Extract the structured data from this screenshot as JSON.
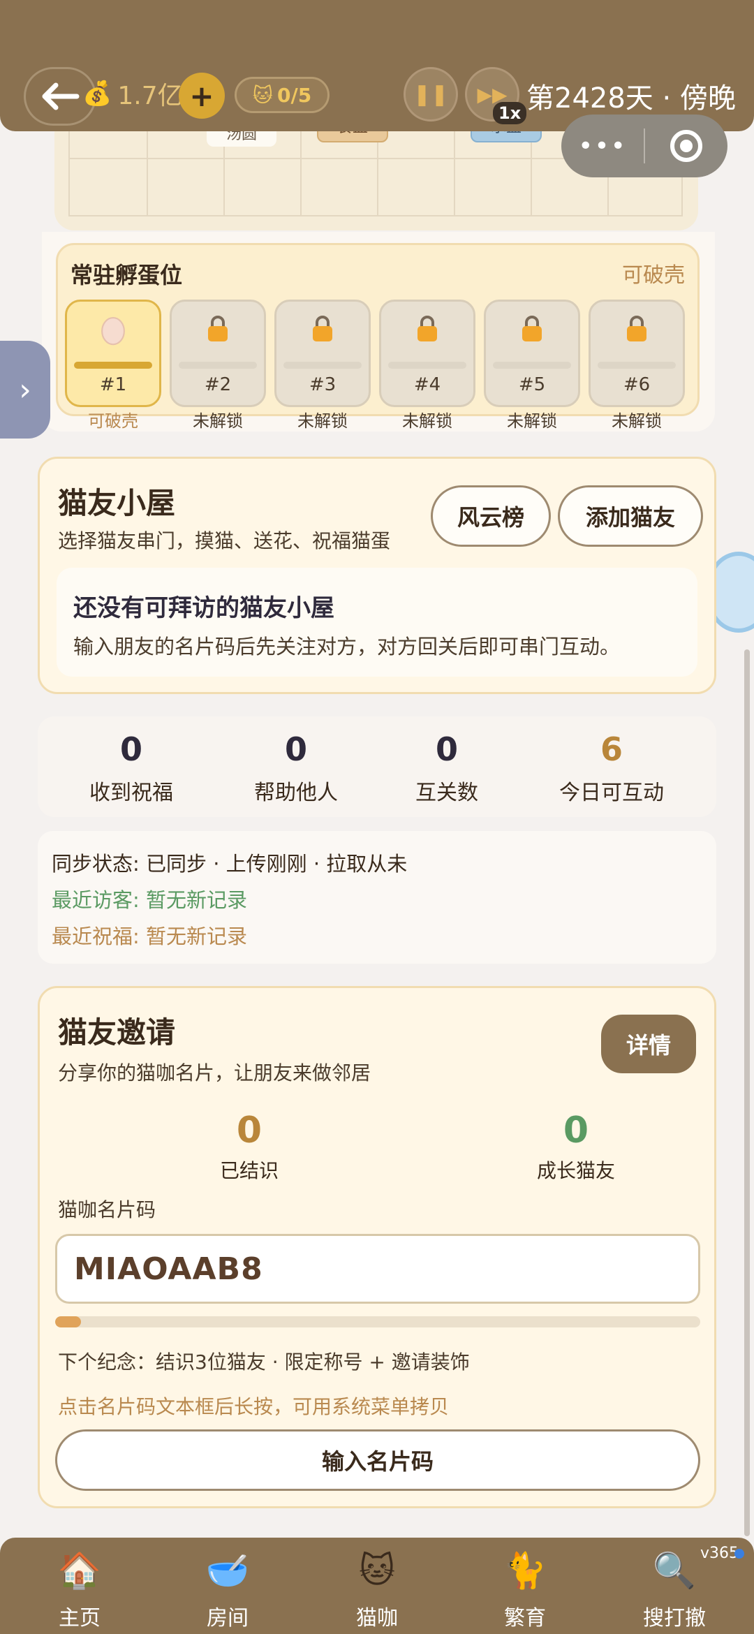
{
  "topbar": {
    "coins": "1.7亿",
    "plus": "+",
    "cat_count": "0/5",
    "speed": "1x",
    "day": "第2428天 · 傍晚",
    "capsule_dots": "•••"
  },
  "room_grid": {
    "items": [
      "汤圆",
      "食盆",
      "水盆"
    ]
  },
  "hatch": {
    "title": "常驻孵蛋位",
    "status": "可破壳",
    "slots": [
      {
        "num": "#1",
        "label": "可破壳"
      },
      {
        "num": "#2",
        "label": "未解锁"
      },
      {
        "num": "#3",
        "label": "未解锁"
      },
      {
        "num": "#4",
        "label": "未解锁"
      },
      {
        "num": "#5",
        "label": "未解锁"
      },
      {
        "num": "#6",
        "label": "未解锁"
      }
    ]
  },
  "friend_house": {
    "title": "猫友小屋",
    "subtitle": "选择猫友串门，摸猫、送花、祝福猫蛋",
    "ranking_button": "风云榜",
    "add_button": "添加猫友",
    "empty_title": "还没有可拜访的猫友小屋",
    "empty_desc": "输入朋友的名片码后先关注对方，对方回关后即可串门互动。"
  },
  "stats": [
    {
      "value": "0",
      "label": "收到祝福"
    },
    {
      "value": "0",
      "label": "帮助他人"
    },
    {
      "value": "0",
      "label": "互关数"
    },
    {
      "value": "6",
      "label": "今日可互动"
    }
  ],
  "sync": {
    "status": "同步状态: 已同步 · 上传刚刚 · 拉取从未",
    "visitors": "最近访客: 暂无新记录",
    "blessings": "最近祝福: 暂无新记录"
  },
  "invite": {
    "title": "猫友邀请",
    "subtitle": "分享你的猫咖名片，让朋友来做邻居",
    "detail_button": "详情",
    "met_value": "0",
    "met_label": "已结识",
    "grow_value": "0",
    "grow_label": "成长猫友",
    "code_label": "猫咖名片码",
    "code": "MIAOAAB8",
    "progress": 0.04,
    "next_milestone": "下个纪念：结识3位猫友 · 限定称号 + 邀请装饰",
    "hint": "点击名片码文本框后长按，可用系统菜单拷贝",
    "input_button": "输入名片码"
  },
  "nav": {
    "items": [
      {
        "label": "主页",
        "icon": "house-icon"
      },
      {
        "label": "房间",
        "icon": "bowl-icon"
      },
      {
        "label": "猫咖",
        "icon": "cat-face-icon"
      },
      {
        "label": "繁育",
        "icon": "cat-couple-icon"
      },
      {
        "label": "搜打撤",
        "icon": "magnifier-icon"
      }
    ],
    "version": "v365"
  },
  "colors": {
    "brand_brown": "#8a7150",
    "accent_gold": "#d8a733",
    "card_cream": "#fff7e6",
    "green": "#5a9a62",
    "orange": "#b9863a"
  }
}
